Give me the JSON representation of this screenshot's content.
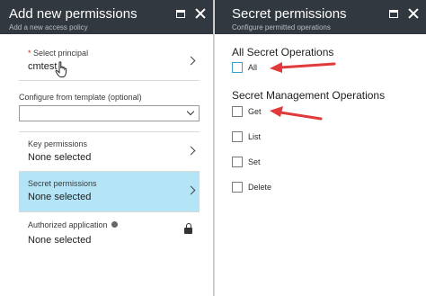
{
  "left_blade": {
    "title": "Add new permissions",
    "subtitle": "Add a new access policy",
    "principal": {
      "required_mark": "*",
      "label": "Select principal",
      "value": "cmtest"
    },
    "template": {
      "label": "Configure from template (optional)",
      "selected": ""
    },
    "key_permissions": {
      "label": "Key permissions",
      "value": "None selected"
    },
    "secret_permissions": {
      "label": "Secret permissions",
      "value": "None selected",
      "highlight_color": "#b3e5f7"
    },
    "authorized_application": {
      "label": "Authorized application",
      "value": "None selected"
    }
  },
  "right_blade": {
    "title": "Secret permissions",
    "subtitle": "Configure permitted operations",
    "sections": [
      {
        "title": "All Secret Operations",
        "options": [
          {
            "label": "All",
            "checked": false
          }
        ]
      },
      {
        "title": "Secret Management Operations",
        "options": [
          {
            "label": "Get",
            "checked": false
          },
          {
            "label": "List",
            "checked": false
          },
          {
            "label": "Set",
            "checked": false
          },
          {
            "label": "Delete",
            "checked": false
          }
        ]
      }
    ]
  },
  "colors": {
    "header": "#32383f",
    "highlight": "#b3e5f7",
    "arrow": "#e03a3a"
  },
  "icons": [
    "maximize-icon",
    "close-icon",
    "chevron-right-icon",
    "chevron-down-icon",
    "info-icon",
    "lock-icon",
    "hand-cursor-icon",
    "arrow-annotation"
  ]
}
